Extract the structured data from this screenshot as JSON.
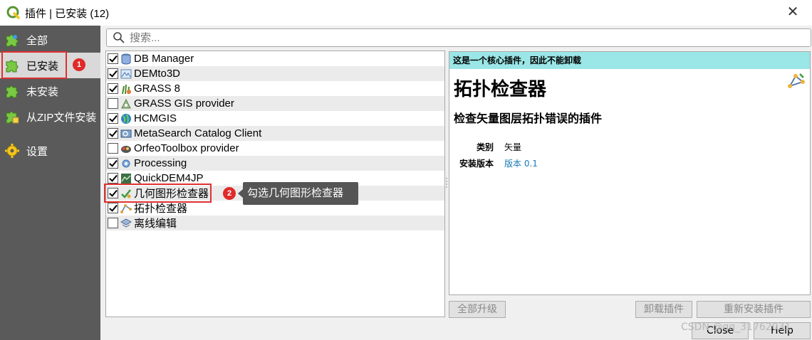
{
  "window": {
    "title": "插件 | 已安装 (12)",
    "close_glyph": "✕"
  },
  "sidebar": {
    "items": [
      {
        "label": "全部",
        "icon": "puzzle-all-icon"
      },
      {
        "label": "已安装",
        "icon": "puzzle-installed-icon"
      },
      {
        "label": "未安装",
        "icon": "puzzle-not-installed-icon"
      },
      {
        "label": "从ZIP文件安装",
        "icon": "puzzle-zip-icon"
      },
      {
        "label": "设置",
        "icon": "gear-icon"
      }
    ],
    "active_index": 1
  },
  "annotations": {
    "badge1": "1",
    "badge2": "2",
    "tooltip": "勾选几何图形检查器"
  },
  "search": {
    "placeholder": "搜索..."
  },
  "plugins": [
    {
      "name": "DB Manager",
      "checked": true,
      "icon": "database-icon"
    },
    {
      "name": "DEMto3D",
      "checked": true,
      "icon": "dem-icon"
    },
    {
      "name": "GRASS 8",
      "checked": true,
      "icon": "grass-icon"
    },
    {
      "name": "GRASS GIS provider",
      "checked": false,
      "icon": "grass-provider-icon"
    },
    {
      "name": "HCMGIS",
      "checked": true,
      "icon": "globe-icon"
    },
    {
      "name": "MetaSearch Catalog Client",
      "checked": true,
      "icon": "metasearch-icon"
    },
    {
      "name": "OrfeoToolbox provider",
      "checked": false,
      "icon": "otb-icon"
    },
    {
      "name": "Processing",
      "checked": true,
      "icon": "processing-gear-icon"
    },
    {
      "name": "QuickDEM4JP",
      "checked": true,
      "icon": "quickdem-icon"
    },
    {
      "name": "几何图形检查器",
      "checked": true,
      "icon": "geometry-check-icon"
    },
    {
      "name": "拓扑检查器",
      "checked": true,
      "icon": "topology-icon"
    },
    {
      "name": "离线编辑",
      "checked": false,
      "icon": "offline-edit-icon"
    }
  ],
  "details": {
    "core_notice": "这是一个核心插件，因此不能卸载",
    "title": "拓扑检查器",
    "subtitle": "检查矢量图层拓扑错误的插件",
    "category_label": "类别",
    "category_value": "矢量",
    "version_label": "安装版本",
    "version_value": "版本 0.1",
    "notice_color": "#9be6e6"
  },
  "buttons": {
    "upgrade_all": "全部升级",
    "uninstall": "卸载插件",
    "reinstall": "重新安装插件",
    "close": "Close",
    "help": "Help"
  },
  "watermark": "CSDN @qq_31762031"
}
